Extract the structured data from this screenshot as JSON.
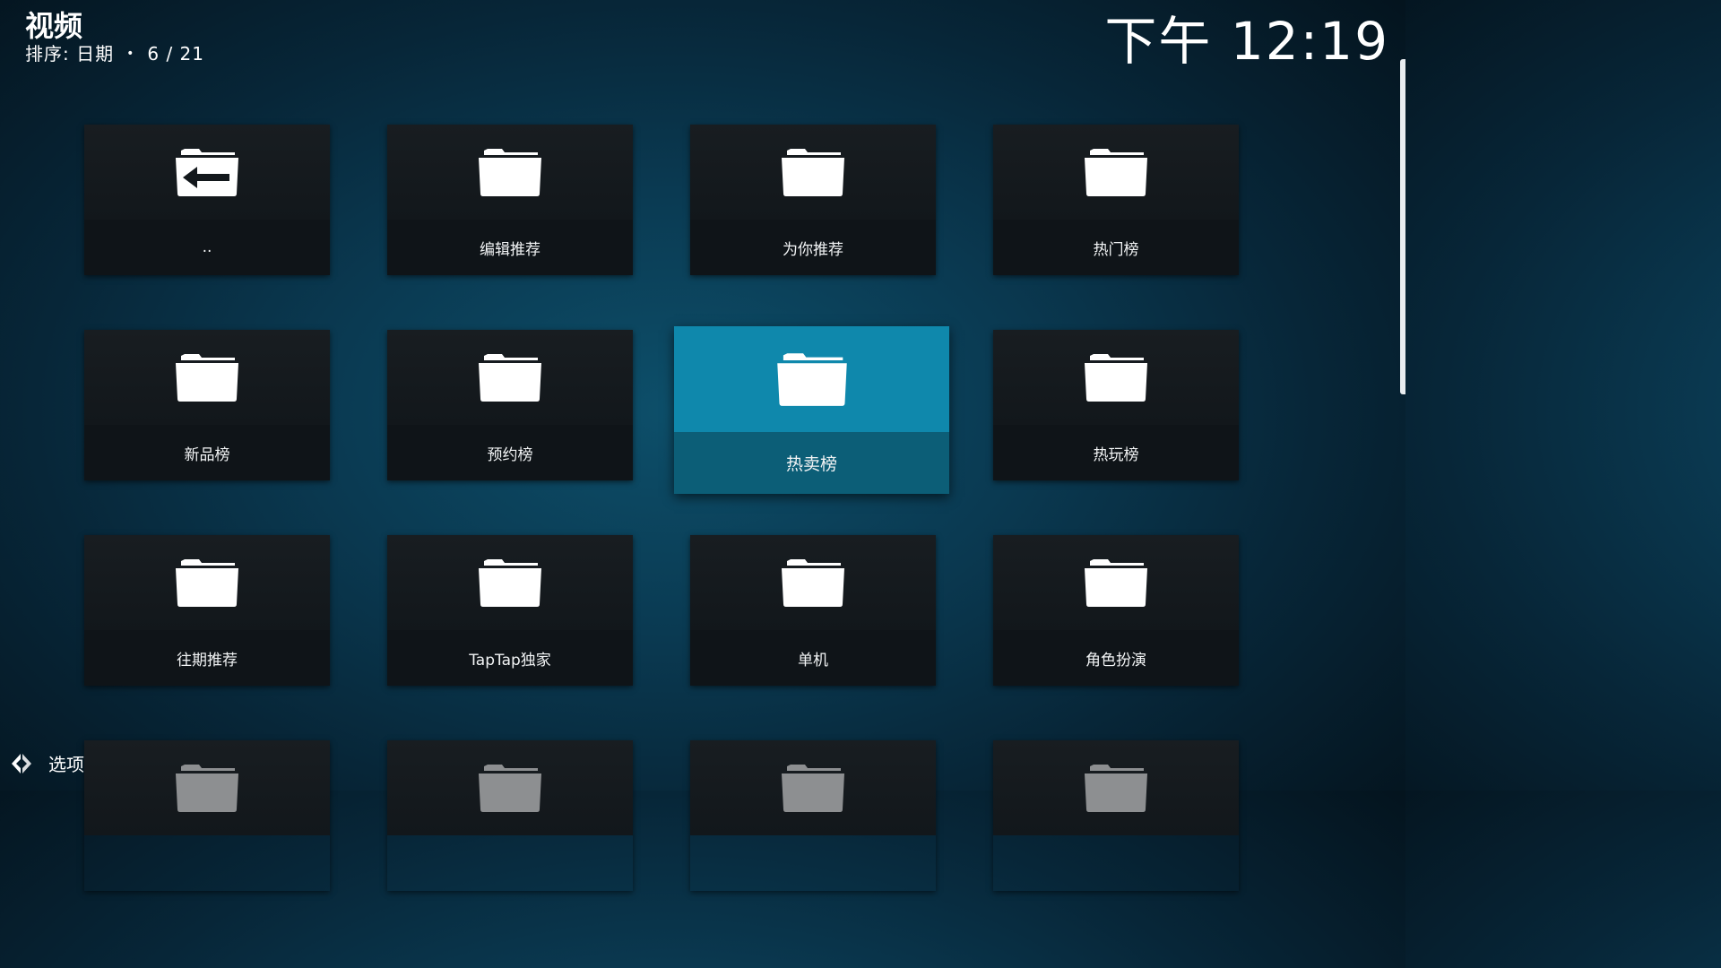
{
  "header": {
    "title": "视频",
    "sort_label": "排序: 日期",
    "dot": "•",
    "position": "6 / 21",
    "clock": "下午 12:19"
  },
  "tiles": [
    {
      "label": "..",
      "icon": "folder-up-icon"
    },
    {
      "label": "编辑推荐",
      "icon": "folder-icon"
    },
    {
      "label": "为你推荐",
      "icon": "folder-icon"
    },
    {
      "label": "热门榜",
      "icon": "folder-icon"
    },
    {
      "label": "新品榜",
      "icon": "folder-icon"
    },
    {
      "label": "预约榜",
      "icon": "folder-icon"
    },
    {
      "label": "热卖榜",
      "icon": "folder-icon",
      "focused": true
    },
    {
      "label": "热玩榜",
      "icon": "folder-icon"
    },
    {
      "label": "往期推荐",
      "icon": "folder-icon"
    },
    {
      "label": "TapTap独家",
      "icon": "folder-icon"
    },
    {
      "label": "单机",
      "icon": "folder-icon"
    },
    {
      "label": "角色扮演",
      "icon": "folder-icon"
    },
    {
      "label": "",
      "icon": "folder-icon"
    },
    {
      "label": "",
      "icon": "folder-icon"
    },
    {
      "label": "",
      "icon": "folder-icon"
    },
    {
      "label": "",
      "icon": "folder-icon"
    }
  ],
  "options": {
    "label": "选项",
    "icon": "options-arrows-icon"
  },
  "colors": {
    "focus_top": "#0f88ac",
    "focus_bottom": "#0c5e77",
    "tile_top": "#181d21",
    "tile_bottom": "#0f1418"
  }
}
